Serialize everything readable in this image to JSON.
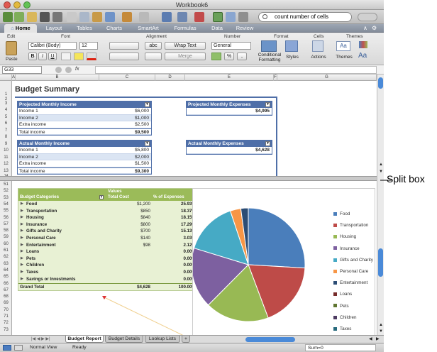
{
  "window": {
    "title": "Workbook6"
  },
  "toolbar": {
    "search_value": "count number of cells"
  },
  "ribbon_tabs": [
    "Home",
    "Layout",
    "Tables",
    "Charts",
    "SmartArt",
    "Formulas",
    "Data",
    "Review"
  ],
  "ribbon": {
    "groups": [
      "Edit",
      "Font",
      "Alignment",
      "Number",
      "Format",
      "Cells",
      "Themes"
    ],
    "paste_label": "Paste",
    "font_name": "Calibri (Body)",
    "font_size": "12",
    "bold": "B",
    "italic": "I",
    "underline": "U",
    "wrap_label": "Wrap Text",
    "merge_label": "Merge",
    "abc_label": "abc",
    "number_format": "General",
    "cond_label_1": "Conditional",
    "cond_label_2": "Formatting",
    "styles_label": "Styles",
    "actions_label": "Actions",
    "themes_label": "Themes",
    "aa_label": "Aa",
    "pct": "%",
    "comma": ","
  },
  "formula_bar": {
    "cell_ref": "G33",
    "fx": "fx"
  },
  "columns": [
    "A",
    "B",
    "C",
    "D",
    "E",
    "F",
    "G"
  ],
  "rows_top": [
    "1",
    "2",
    "3",
    "4",
    "5",
    "6",
    "7",
    "8",
    "9",
    "10",
    "11",
    "12",
    "13",
    "14"
  ],
  "rows_bottom": [
    "51",
    "52",
    "53",
    "54",
    "55",
    "56",
    "57",
    "58",
    "59",
    "60",
    "61",
    "62",
    "63",
    "64",
    "65",
    "66",
    "67",
    "68",
    "69",
    "70",
    "71",
    "72",
    "73"
  ],
  "sheet": {
    "title": "Budget Summary",
    "projected_income": {
      "header": "Projected Monthly Income",
      "rows": [
        [
          "Income 1",
          "$6,000"
        ],
        [
          "Income 2",
          "$1,000"
        ],
        [
          "Extra income",
          "$2,500"
        ]
      ],
      "total": [
        "Total income",
        "$9,500"
      ]
    },
    "actual_income": {
      "header": "Actual Monthly Income",
      "rows": [
        [
          "Income 1",
          "$5,800"
        ],
        [
          "Income 2",
          "$2,000"
        ],
        [
          "Extra income",
          "$1,500"
        ]
      ],
      "total": [
        "Total income",
        "$9,300"
      ]
    },
    "projected_expenses": {
      "header": "Projected Monthly Expenses",
      "value": "$4,995"
    },
    "actual_expenses": {
      "header": "Actual Monthly Expenses",
      "value": "$4,628"
    }
  },
  "pivot": {
    "values_label": "Values",
    "col_category": "Budget Categories",
    "col_total": "Total Cost",
    "col_pct": "% of Expenses",
    "rows": [
      {
        "name": "Food",
        "cost": "$1,200",
        "pct": "25.93%"
      },
      {
        "name": "Transportation",
        "cost": "$850",
        "pct": "18.37%"
      },
      {
        "name": "Housing",
        "cost": "$840",
        "pct": "18.15%"
      },
      {
        "name": "Insurance",
        "cost": "$800",
        "pct": "17.29%"
      },
      {
        "name": "Gifts and Charity",
        "cost": "$700",
        "pct": "15.13%"
      },
      {
        "name": "Personal Care",
        "cost": "$140",
        "pct": "3.03%"
      },
      {
        "name": "Entertainment",
        "cost": "$98",
        "pct": "2.12%"
      },
      {
        "name": "Loans",
        "cost": "",
        "pct": "0.00%"
      },
      {
        "name": "Pets",
        "cost": "",
        "pct": "0.00%"
      },
      {
        "name": "Children",
        "cost": "",
        "pct": "0.00%"
      },
      {
        "name": "Taxes",
        "cost": "",
        "pct": "0.00%"
      },
      {
        "name": "Savings or Investments",
        "cost": "",
        "pct": "0.00%"
      }
    ],
    "grand_total": {
      "name": "Grand Total",
      "cost": "$4,628",
      "pct": "100.00%"
    }
  },
  "chart_data": {
    "type": "pie",
    "categories": [
      "Food",
      "Transportation",
      "Housing",
      "Insurance",
      "Gifts and Charity",
      "Personal Care",
      "Entertainment",
      "Loans",
      "Pets",
      "Children",
      "Taxes"
    ],
    "values": [
      1200,
      850,
      840,
      800,
      700,
      140,
      98,
      0,
      0,
      0,
      0
    ],
    "colors": [
      "#4a7ebb",
      "#be4b48",
      "#98b954",
      "#7d60a0",
      "#46aac5",
      "#f79646",
      "#2c4d75",
      "#772c2a",
      "#5f7530",
      "#4d3b62",
      "#276a7c"
    ],
    "legend_position": "right"
  },
  "sheet_tabs": [
    "Budget Report",
    "Budget Details",
    "Lookup Lists"
  ],
  "status": {
    "view": "Normal View",
    "state": "Ready",
    "sum": "Sum=0"
  },
  "annotation": "Split box"
}
